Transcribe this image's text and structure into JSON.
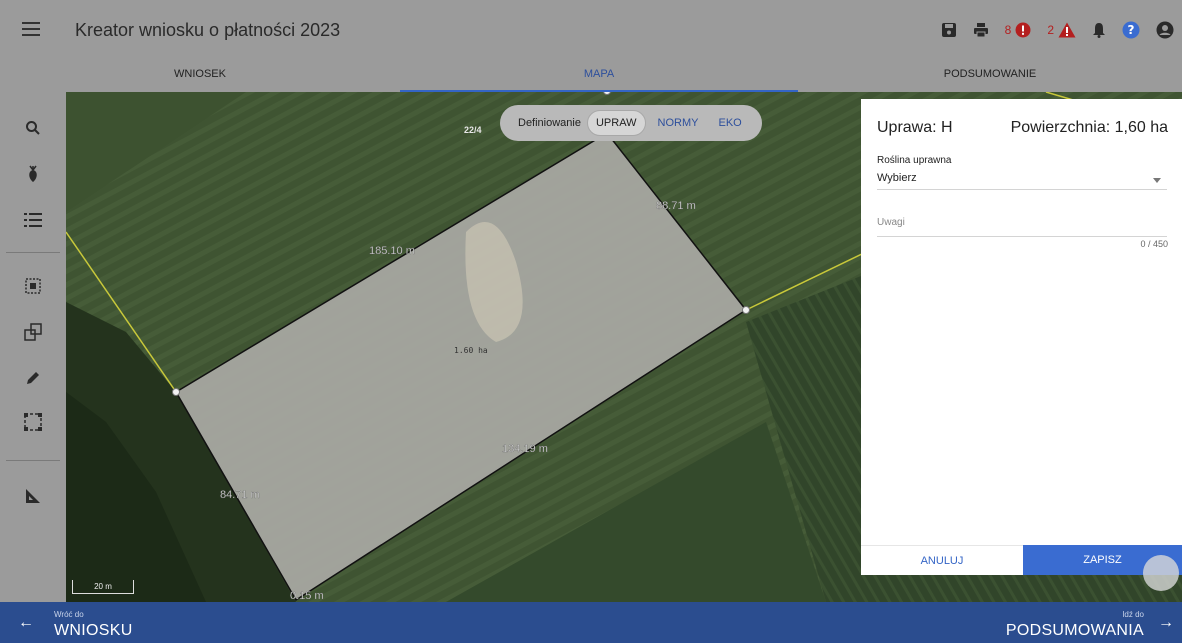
{
  "header": {
    "title": "Kreator wniosku o płatności 2023",
    "error_count": "8",
    "warning_count": "2"
  },
  "tabs": [
    {
      "label": "WNIOSEK",
      "active": false
    },
    {
      "label": "MAPA",
      "active": true
    },
    {
      "label": "PODSUMOWANIE",
      "active": false
    }
  ],
  "map": {
    "parcel_label": "22/4",
    "area_label": "1.60 ha",
    "edges": {
      "top": "185.10 m",
      "right": "88.71 m",
      "bottom": "134.19 m",
      "left": "84.71 m",
      "corner": "0.15 m"
    },
    "scale": "20 m",
    "segment": {
      "label": "Definiowanie",
      "options": [
        "UPRAW",
        "NORMY",
        "EKO"
      ],
      "active": "UPRAW"
    }
  },
  "panel": {
    "title": "Uprawa: H",
    "area": "Powierzchnia: 1,60 ha",
    "crop_label": "Roślina uprawna",
    "crop_value": "Wybierz",
    "notes_placeholder": "Uwagi",
    "notes_counter": "0 / 450",
    "cancel": "ANULUJ",
    "save": "ZAPISZ"
  },
  "footer": {
    "back_small": "Wróć do",
    "back_big": "WNIOSKU",
    "next_small": "Idź do",
    "next_big": "PODSUMOWANIA"
  },
  "colors": {
    "primary": "#3a6cd1",
    "footer": "#2b4d8f",
    "error": "#b41f1f"
  },
  "icons": [
    "menu-icon",
    "save-icon",
    "print-icon",
    "error-icon",
    "warning-icon",
    "bell-icon",
    "help-icon",
    "account-icon",
    "search-icon",
    "crop-icon",
    "list-icon",
    "select-area-icon",
    "copy-shape-icon",
    "pencil-icon",
    "frame-icon",
    "measure-icon",
    "arrow-left-icon",
    "arrow-right-icon"
  ]
}
